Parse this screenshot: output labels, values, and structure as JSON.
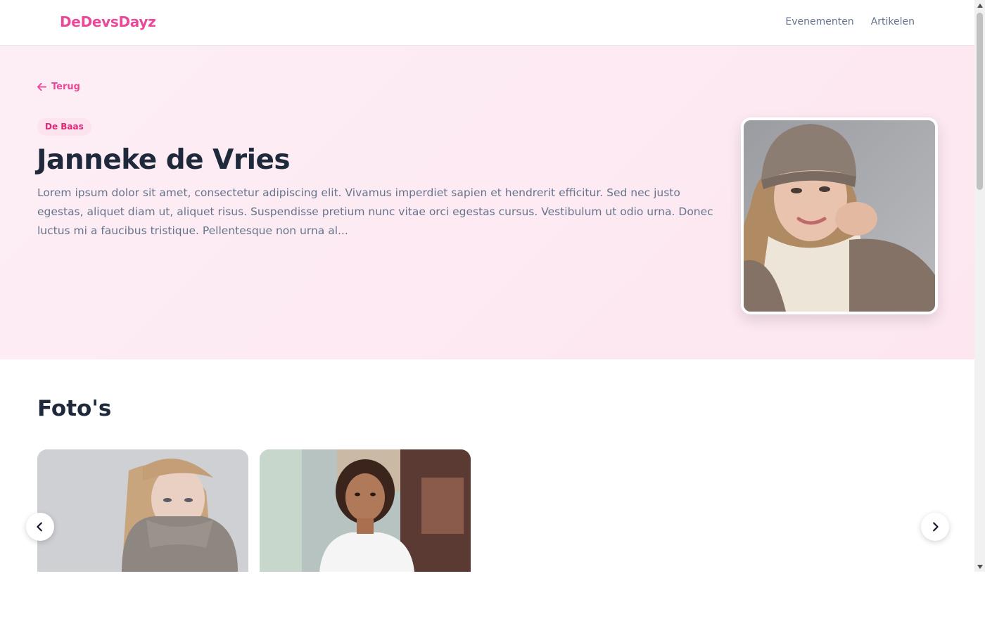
{
  "header": {
    "brand": "DeDevsDayz",
    "nav": [
      {
        "label": "Evenementen"
      },
      {
        "label": "Artikelen"
      }
    ]
  },
  "hero": {
    "back_label": "Terug",
    "role_badge": "De Baas",
    "name": "Janneke de Vries",
    "bio": "Lorem ipsum dolor sit amet, consectetur adipiscing elit. Vivamus imperdiet sapien et hendrerit efficitur. Sed nec justo egestas, aliquet diam ut, aliquet risus. Suspendisse pretium nunc vitae orci egestas cursus. Vestibulum ut odio urna. Donec luctus mi a faucibus tristique. Pellentesque non urna al..."
  },
  "photos": {
    "title": "Foto's"
  },
  "colors": {
    "accent": "#ec4899",
    "hero_bg": "#fdeef5",
    "text_dark": "#1e293b",
    "text_muted": "#64748b"
  }
}
